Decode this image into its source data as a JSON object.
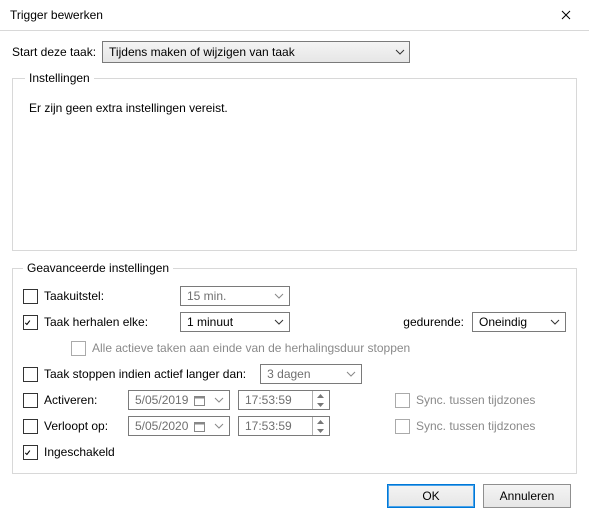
{
  "window": {
    "title": "Trigger bewerken"
  },
  "start": {
    "label": "Start deze taak:",
    "value": "Tijdens maken of wijzigen van taak"
  },
  "settings_group": {
    "legend": "Instellingen",
    "message": "Er zijn geen extra instellingen vereist."
  },
  "advanced": {
    "legend": "Geavanceerde instellingen",
    "delay": {
      "checked": false,
      "label": "Taakuitstel:",
      "value": "15 min."
    },
    "repeat": {
      "checked": true,
      "label": "Taak herhalen elke:",
      "value": "1 minuut",
      "duration_label": "gedurende:",
      "duration_value": "Oneindig"
    },
    "stop_all": {
      "checked": false,
      "enabled": false,
      "label": "Alle actieve taken aan einde van de herhalingsduur stoppen"
    },
    "stop_if": {
      "checked": false,
      "label": "Taak stoppen indien actief langer dan:",
      "value": "3 dagen"
    },
    "activate": {
      "checked": false,
      "label": "Activeren:",
      "date": "5/05/2019",
      "time": "17:53:59",
      "sync_label": "Sync. tussen tijdzones",
      "sync_checked": false,
      "sync_enabled": false
    },
    "expire": {
      "checked": false,
      "label": "Verloopt op:",
      "date": "5/05/2020",
      "time": "17:53:59",
      "sync_label": "Sync. tussen tijdzones",
      "sync_checked": false,
      "sync_enabled": false
    },
    "enabled": {
      "checked": true,
      "label": "Ingeschakeld"
    }
  },
  "buttons": {
    "ok": "OK",
    "cancel": "Annuleren"
  }
}
